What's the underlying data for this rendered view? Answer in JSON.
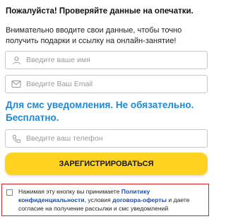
{
  "notice": {
    "title": "Пожалуйста! Проверяйте данные на опечатки.",
    "text": "Внимательно вводите свои данные, чтобы точно получить подарки и ссылку на онлайн-занятие!"
  },
  "form": {
    "name_placeholder": "Введите ваше имя",
    "email_placeholder": "Введите Ваш Email",
    "sms_heading": "Для смс уведомления. Не обязательно. Бесплатно.",
    "phone_placeholder": "Введите ваш телефон",
    "submit_label": "ЗАРЕГИСТРИРОВАТЬСЯ"
  },
  "consent": {
    "text_before": "Нажимая эту кнопку вы принимаете ",
    "privacy_link": "Политику конфиденциальности",
    "text_middle": ", условия ",
    "offer_link": "договора-оферты",
    "text_after": " и даете согласие на получение рассылки и смс уведомлений"
  },
  "icons": {
    "name_field": "user-icon",
    "email_field": "envelope-icon",
    "phone_field": "phone-icon"
  },
  "colors": {
    "accent_blue": "#1e88d6",
    "button_yellow": "#ffd21f",
    "consent_border": "#e02020",
    "link": "#1c4fa8"
  }
}
